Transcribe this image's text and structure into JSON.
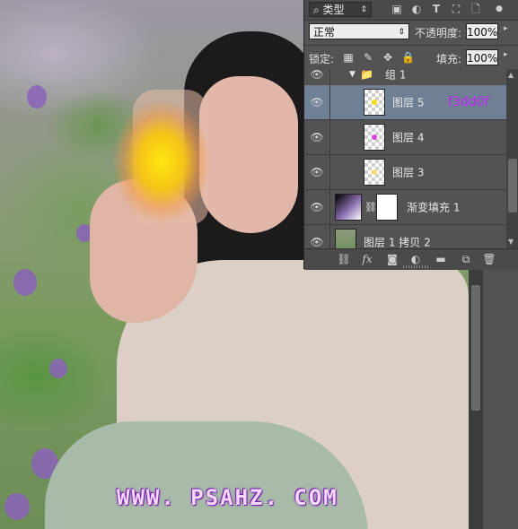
{
  "canvas": {
    "watermark": "WWW. PSAHZ. COM",
    "glow_color": "#ffe80e"
  },
  "filter_bar": {
    "filter_select": "⌕ 类型",
    "icons": [
      "image-filter-icon",
      "adjustment-filter-icon",
      "type-filter-icon",
      "shape-filter-icon",
      "smart-object-filter-icon"
    ]
  },
  "blend": {
    "mode": "正常",
    "opacity_label": "不透明度:",
    "opacity_value": "100%"
  },
  "lock": {
    "label": "锁定:",
    "icons": [
      "lock-transparent-icon",
      "lock-image-icon",
      "lock-position-icon",
      "lock-all-icon"
    ],
    "fill_label": "填充:",
    "fill_value": "100%"
  },
  "layers": [
    {
      "name": "组 1",
      "type": "group",
      "expanded": true
    },
    {
      "name": "图层 5",
      "selected": true,
      "tag": "f3dd0f",
      "thumb_dot": "#ffe80e"
    },
    {
      "name": "图层 4",
      "thumb_dot": "#e040e0"
    },
    {
      "name": "图层 3",
      "thumb_dot": "#f5e07a"
    },
    {
      "name": "渐变填充 1",
      "type": "fill"
    },
    {
      "name": "图层 1 拷贝 2"
    }
  ],
  "footer_icons": [
    "link-layers-icon",
    "fx-icon",
    "add-mask-icon",
    "adjustment-layer-icon",
    "new-group-icon",
    "new-layer-icon",
    "trash-icon"
  ],
  "footer_fx": "fx"
}
